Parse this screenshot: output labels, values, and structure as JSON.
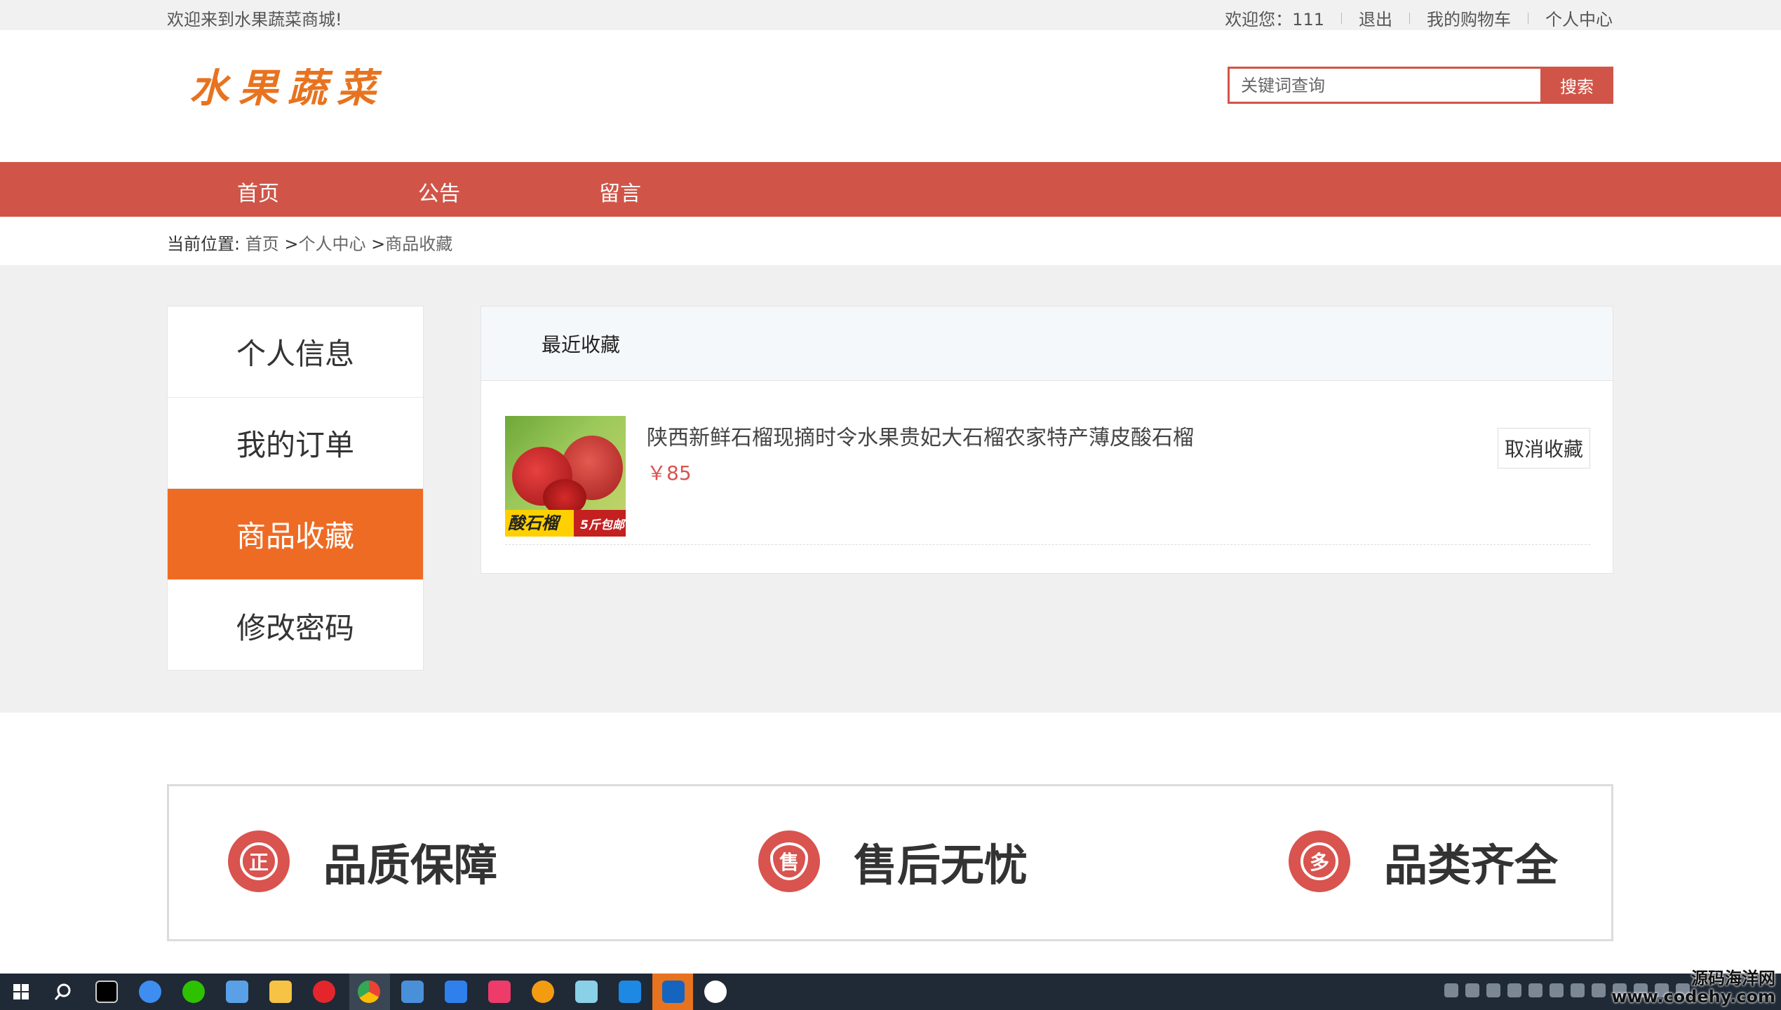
{
  "topbar": {
    "welcome": "欢迎来到水果蔬菜商城!",
    "user_greeting": "欢迎您：111",
    "logout": "退出",
    "cart": "我的购物车",
    "profile": "个人中心"
  },
  "header": {
    "logo": "水果蔬菜",
    "search_placeholder": "关键词查询",
    "search_button": "搜索"
  },
  "nav": {
    "items": [
      {
        "label": "首页"
      },
      {
        "label": "公告"
      },
      {
        "label": "留言"
      }
    ]
  },
  "breadcrumb": {
    "prefix": "当前位置:",
    "home": "首页",
    "sep1": ">",
    "level1": "个人中心",
    "sep2": ">",
    "level2": "商品收藏"
  },
  "sidebar": {
    "items": [
      {
        "label": "个人信息",
        "active": false
      },
      {
        "label": "我的订单",
        "active": false
      },
      {
        "label": "商品收藏",
        "active": true
      },
      {
        "label": "修改密码",
        "active": false
      }
    ]
  },
  "favorites": {
    "heading": "最近收藏",
    "items": [
      {
        "title": "陕西新鲜石榴现摘时令水果贵妃大石榴农家特产薄皮酸石榴",
        "price": "￥85",
        "cancel_label": "取消收藏",
        "thumb_text_left": "酸石榴",
        "thumb_text_right": "5斤包邮"
      }
    ]
  },
  "features": [
    {
      "icon_glyph": "正",
      "label": "品质保障"
    },
    {
      "icon_glyph": "售",
      "label": "售后无忧"
    },
    {
      "icon_glyph": "多",
      "label": "品类齐全"
    }
  ],
  "watermark": {
    "line1": "源码海洋网",
    "line2": "www.codehy.com"
  },
  "colors": {
    "accent_red": "#d05548",
    "active_orange": "#ee6b24",
    "price_red": "#d9534f",
    "logo_orange": "#e8731f"
  }
}
